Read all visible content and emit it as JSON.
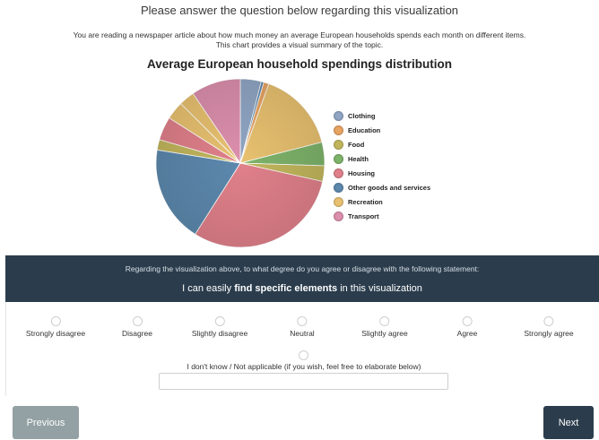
{
  "page": {
    "heading": "Please answer the question below regarding this visualization",
    "intro_line1": "You are reading a newspaper article about how much money an average European households spends each month on different items.",
    "intro_line2": "This chart provides a visual summary of the topic."
  },
  "chart_data": {
    "type": "pie",
    "title": "Average European household spendings distribution",
    "legend_position": "right",
    "categories": [
      "Clothing",
      "Education",
      "Food",
      "Health",
      "Housing",
      "Other goods and services",
      "Recreation",
      "Transport"
    ],
    "colors": [
      "#90a6c4",
      "#e8a462",
      "#c2b65c",
      "#7eb36a",
      "#e0808a",
      "#5c88ad",
      "#e8c170",
      "#dc8fac"
    ],
    "slices": [
      {
        "category": "Clothing",
        "value": 4.0
      },
      {
        "category": "Other goods and services",
        "value": 0.5
      },
      {
        "category": "Education",
        "value": 1.0
      },
      {
        "category": "Recreation",
        "value": 15.5
      },
      {
        "category": "Health",
        "value": 4.5
      },
      {
        "category": "Food",
        "value": 3.0
      },
      {
        "category": "Housing",
        "value": 30.5
      },
      {
        "category": "Other goods and services",
        "value": 18.5
      },
      {
        "category": "Food",
        "value": 2.0
      },
      {
        "category": "Housing",
        "value": 4.5
      },
      {
        "category": "Recreation",
        "value": 3.5
      },
      {
        "category": "Recreation",
        "value": 3.0
      },
      {
        "category": "Transport",
        "value": 9.5
      }
    ]
  },
  "question": {
    "prompt": "Regarding the visualization above, to what degree do you agree or disagree with the following statement:",
    "statement_prefix": "I can easily",
    "statement_bold": "find specific elements",
    "statement_suffix": "in this visualization"
  },
  "scale": {
    "options": [
      "Strongly disagree",
      "Disagree",
      "Slightly disagree",
      "Neutral",
      "Slightly agree",
      "Agree",
      "Strongly agree"
    ],
    "dont_know_label": "I don't know / Not applicable (if you wish, feel free to elaborate below)",
    "elaborate_value": ""
  },
  "nav": {
    "previous_label": "Previous",
    "next_label": "Next"
  }
}
